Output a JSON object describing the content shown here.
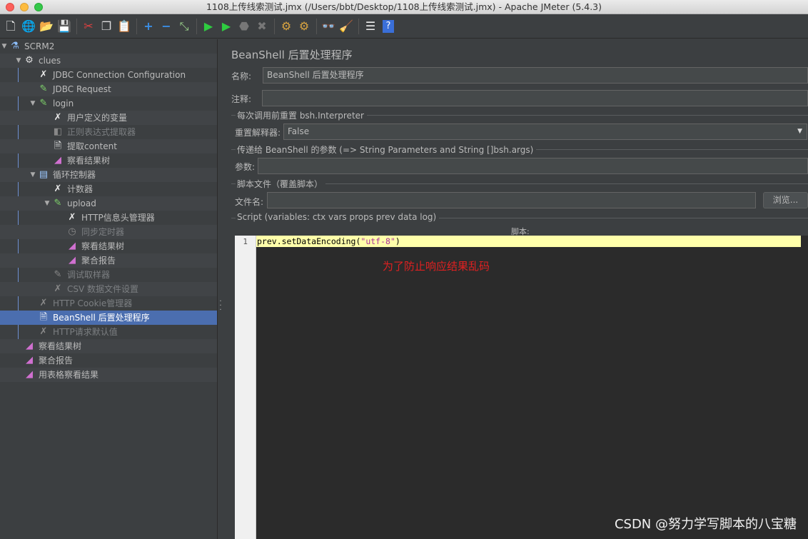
{
  "window": {
    "title": "1108上传线索测试.jmx (/Users/bbt/Desktop/1108上传线索测试.jmx) - Apache JMeter (5.4.3)"
  },
  "toolbar": {
    "icons": [
      "new-icon",
      "templates-icon",
      "open-icon",
      "save-icon",
      "cut-icon",
      "copy-icon",
      "paste-icon",
      "expand-icon",
      "collapse-icon",
      "toggle-icon",
      "start-icon",
      "start-no-pause-icon",
      "stop-icon",
      "shutdown-icon",
      "clear-icon",
      "clear-all-icon",
      "search-icon",
      "reset-search-icon",
      "function-helper-icon",
      "help-icon"
    ]
  },
  "tree": {
    "items": [
      {
        "label": "SCRM2",
        "icon": "flask-icon"
      },
      {
        "label": "clues",
        "icon": "gear-icon"
      },
      {
        "label": "JDBC Connection Configuration",
        "icon": "wrench-icon"
      },
      {
        "label": "JDBC Request",
        "icon": "pipette-icon"
      },
      {
        "label": "login",
        "icon": "pipette-icon"
      },
      {
        "label": "用户定义的变量",
        "icon": "wrench-icon"
      },
      {
        "label": "正则表达式提取器",
        "icon": "extractor-icon"
      },
      {
        "label": "提取content",
        "icon": "script-icon"
      },
      {
        "label": "察看结果树",
        "icon": "chart-icon"
      },
      {
        "label": "循环控制器",
        "icon": "loop-icon"
      },
      {
        "label": "计数器",
        "icon": "wrench-icon"
      },
      {
        "label": "upload",
        "icon": "pipette-icon"
      },
      {
        "label": "HTTP信息头管理器",
        "icon": "wrench-icon"
      },
      {
        "label": "同步定时器",
        "icon": "timer-icon"
      },
      {
        "label": "察看结果树",
        "icon": "chart-icon"
      },
      {
        "label": "聚合报告",
        "icon": "chart-icon"
      },
      {
        "label": "调试取样器",
        "icon": "pipette-icon"
      },
      {
        "label": "CSV 数据文件设置",
        "icon": "wrench-icon"
      },
      {
        "label": "HTTP Cookie管理器",
        "icon": "wrench-icon"
      },
      {
        "label": "BeanShell 后置处理程序",
        "icon": "script-icon"
      },
      {
        "label": "HTTP请求默认值",
        "icon": "wrench-icon"
      },
      {
        "label": "察看结果树",
        "icon": "chart-icon"
      },
      {
        "label": "聚合报告",
        "icon": "chart-icon"
      },
      {
        "label": "用表格察看结果",
        "icon": "chart-icon"
      }
    ]
  },
  "panel": {
    "title": "BeanShell 后置处理程序",
    "name_label": "名称:",
    "name_value": "BeanShell 后置处理程序",
    "comment_label": "注释:",
    "comment_value": "",
    "reset_section": "每次调用前重置 bsh.Interpreter",
    "reset_label": "重置解释器:",
    "reset_value": "False",
    "params_section": "传递给 BeanShell 的参数 (=> String Parameters and String []bsh.args)",
    "params_label": "参数:",
    "params_value": "",
    "file_section": "脚本文件（覆盖脚本）",
    "file_label": "文件名:",
    "file_value": "",
    "browse_button": "浏览...",
    "script_section": "Script (variables: ctx vars props prev data log)",
    "script_label": "脚本:",
    "line_number": "1",
    "code_prefix": "prev.setDataEncoding(",
    "code_string": "\"utf-8\"",
    "code_suffix": ")",
    "annotation": "为了防止响应结果乱码"
  },
  "watermark": "CSDN @努力学写脚本的八宝糖"
}
